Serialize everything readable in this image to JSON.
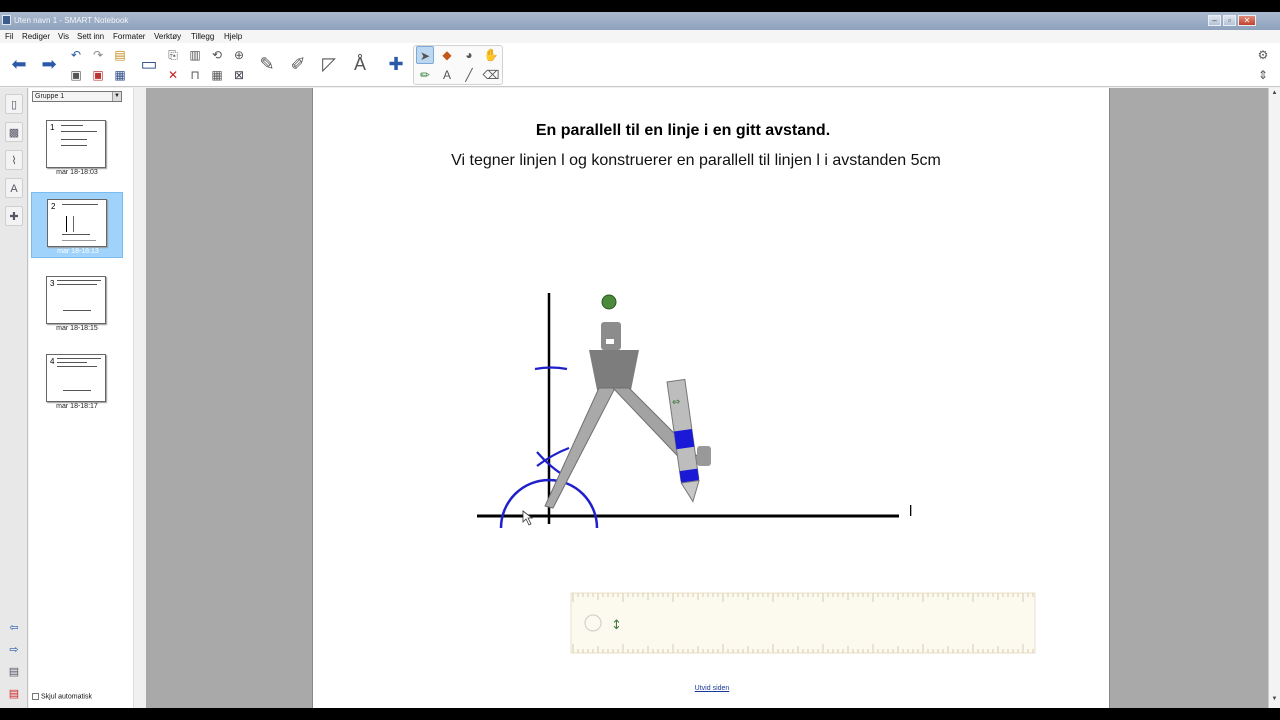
{
  "window": {
    "title": "Uten navn 1 - SMART Notebook"
  },
  "menu": [
    "Fil",
    "Rediger",
    "Vis",
    "Sett inn",
    "Formater",
    "Verktøy",
    "Tillegg",
    "Hjelp"
  ],
  "sorter": {
    "group": "Gruppe 1",
    "pages": [
      {
        "num": "1",
        "label": "mar 18-18:03"
      },
      {
        "num": "2",
        "label": "mar 18-18:13"
      },
      {
        "num": "3",
        "label": "mar 18-18:15"
      },
      {
        "num": "4",
        "label": "mar 18-18:17"
      }
    ],
    "active_index": 1,
    "auto_hide": "Skjul automatisk"
  },
  "page": {
    "title": "En parallell til en linje i en gitt avstand.",
    "subtitle": "Vi tegner linjen l og konstruerer en parallell til linjen l i avstanden 5cm",
    "line_label": "l",
    "expand_link": "Utvid siden"
  },
  "colors": {
    "arc": "#1f1fcc",
    "line": "#000000",
    "compass": "#8a8a8a",
    "pencil_tip": "#1a1ad6",
    "selection": "#9fd3fb"
  }
}
